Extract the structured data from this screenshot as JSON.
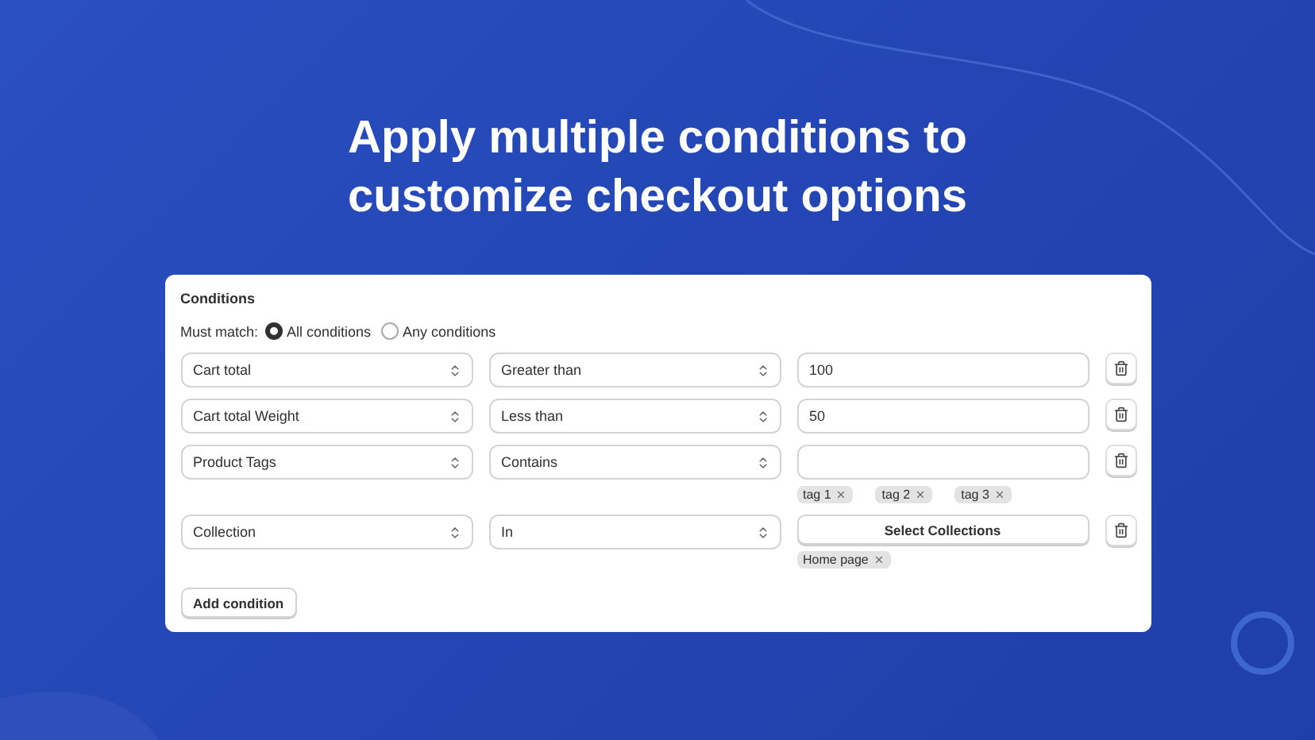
{
  "headline": [
    "Apply multiple conditions to",
    "customize checkout options"
  ],
  "card": {
    "title": "Conditions",
    "match": {
      "label": "Must match:",
      "options": [
        {
          "label": "All conditions",
          "selected": true
        },
        {
          "label": "Any conditions",
          "selected": false
        }
      ]
    },
    "rows": [
      {
        "field": "Cart total",
        "operator": "Greater than",
        "value": {
          "kind": "input",
          "text": "100"
        },
        "tags": []
      },
      {
        "field": "Cart total Weight",
        "operator": "Less than",
        "value": {
          "kind": "input",
          "text": "50"
        },
        "tags": []
      },
      {
        "field": "Product Tags",
        "operator": "Contains",
        "value": {
          "kind": "input"
        },
        "tags": [
          "tag 1",
          "tag 2",
          "tag 3"
        ]
      },
      {
        "field": "Collection",
        "operator": "In",
        "value": {
          "kind": "button",
          "text": "Select Collections"
        },
        "tags": [
          "Home page"
        ]
      }
    ],
    "add_button": "Add condition"
  }
}
